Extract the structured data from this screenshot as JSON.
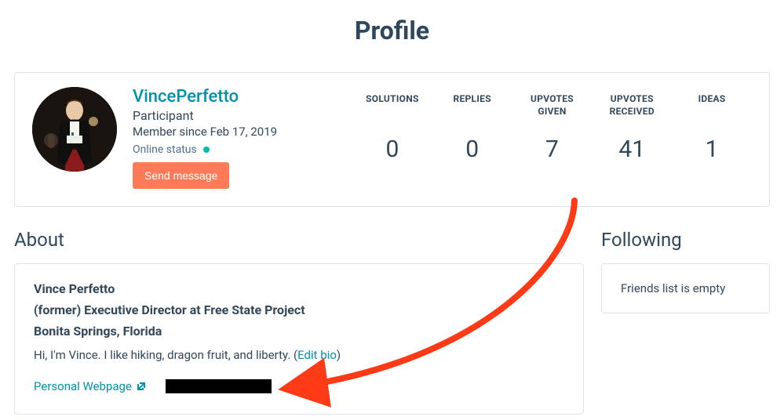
{
  "page": {
    "title": "Profile"
  },
  "user": {
    "username": "VincePerfetto",
    "role": "Participant",
    "member_since": "Member since Feb 17, 2019",
    "online_label": "Online status",
    "send_message_label": "Send message"
  },
  "stats": {
    "solutions": {
      "label": "SOLUTIONS",
      "value": "0"
    },
    "replies": {
      "label": "REPLIES",
      "value": "0"
    },
    "upvotes_given": {
      "label_line1": "UPVOTES",
      "label_line2": "GIVEN",
      "value": "7"
    },
    "upvotes_received": {
      "label_line1": "UPVOTES",
      "label_line2": "RECEIVED",
      "value": "41"
    },
    "ideas": {
      "label": "IDEAS",
      "value": "1"
    }
  },
  "about": {
    "heading": "About",
    "name": "Vince Perfetto",
    "title": "(former) Executive Director at Free State Project",
    "location": "Bonita Springs, Florida",
    "bio_prefix": "Hi, I'm Vince. I like hiking, dragon fruit, and liberty. (",
    "edit_bio_label": "Edit bio",
    "bio_suffix": ")",
    "webpage_label": "Personal Webpage"
  },
  "following": {
    "heading": "Following",
    "empty_text": "Friends list is empty"
  },
  "annotation": {
    "arrow_color": "#ff3b17"
  }
}
